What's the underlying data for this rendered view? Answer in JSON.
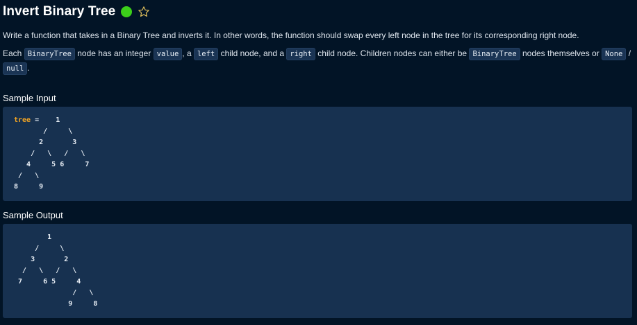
{
  "page": {
    "title": "Invert Binary Tree",
    "status_color": "#3ccf1a",
    "star_color": "#e3c15d",
    "description": "Write a function that takes in a Binary Tree and inverts it. In other words, the function should swap every left node in the tree for its corresponding right node.",
    "details": {
      "t1": "Each ",
      "c1": "BinaryTree",
      "t2": " node has an integer ",
      "c2": "value",
      "t3": ", a ",
      "c3": "left",
      "t4": " child node, and a ",
      "c4": "right",
      "t5": " child node. Children nodes can either be ",
      "c5": "BinaryTree",
      "t6": " nodes themselves or ",
      "c6": "None",
      "t7": " / ",
      "c7": "null",
      "t8": "."
    }
  },
  "sample_input": {
    "label": "Sample Input",
    "var_name": "tree",
    "first_line_rest": " =    1",
    "body": "       /     \\\n      2       3\n    /   \\   /   \\\n   4     5 6     7\n /   \\\n8     9"
  },
  "sample_output": {
    "label": "Sample Output",
    "body": "        1\n     /     \\\n    3       2\n  /   \\   /   \\\n 7     6 5     4\n              /   \\\n             9     8"
  }
}
